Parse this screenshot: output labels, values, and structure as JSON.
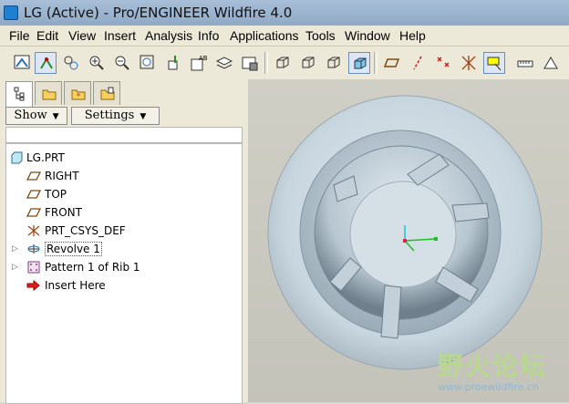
{
  "window": {
    "title": "LG (Active) - Pro/ENGINEER Wildfire 4.0"
  },
  "menu": [
    "File",
    "Edit",
    "View",
    "Insert",
    "Analysis",
    "Info",
    "Applications",
    "Tools",
    "Window",
    "Help"
  ],
  "toolbar_icons": [
    "repaint-icon",
    "spin-center-icon",
    "orient-icon",
    "zoom-in-icon",
    "zoom-out-icon",
    "refit-icon",
    "reorient-icon",
    "saved-views-icon",
    "layers-icon",
    "view-manager-icon",
    "wireframe-icon",
    "hidden-line-icon",
    "no-hidden-icon",
    "shading-icon",
    "datum-plane-icon",
    "datum-axis-icon",
    "datum-point-icon",
    "csys-icon",
    "annotation-icon",
    "measure-icon",
    "analysis-icon"
  ],
  "navigator": {
    "tabs": [
      "model-tree-tab",
      "folder-browser-tab",
      "favorites-tab",
      "connections-tab"
    ],
    "show_label": "Show",
    "settings_label": "Settings"
  },
  "model_tree": [
    {
      "label": "LG.PRT",
      "icon": "part-icon",
      "indent": 0,
      "expandable": false
    },
    {
      "label": "RIGHT",
      "icon": "datum-plane-icon",
      "indent": 1,
      "expandable": false
    },
    {
      "label": "TOP",
      "icon": "datum-plane-icon",
      "indent": 1,
      "expandable": false
    },
    {
      "label": "FRONT",
      "icon": "datum-plane-icon",
      "indent": 1,
      "expandable": false
    },
    {
      "label": "PRT_CSYS_DEF",
      "icon": "csys-icon",
      "indent": 1,
      "expandable": false
    },
    {
      "label": "Revolve 1",
      "icon": "revolve-icon",
      "indent": 1,
      "expandable": true
    },
    {
      "label": "Pattern 1 of Rib 1",
      "icon": "pattern-icon",
      "indent": 1,
      "expandable": true
    },
    {
      "label": "Insert Here",
      "icon": "insert-here-arrow-icon",
      "indent": 1,
      "expandable": false
    }
  ],
  "watermark": {
    "text": "野火论坛",
    "url": "www.proewildfire.cn"
  }
}
